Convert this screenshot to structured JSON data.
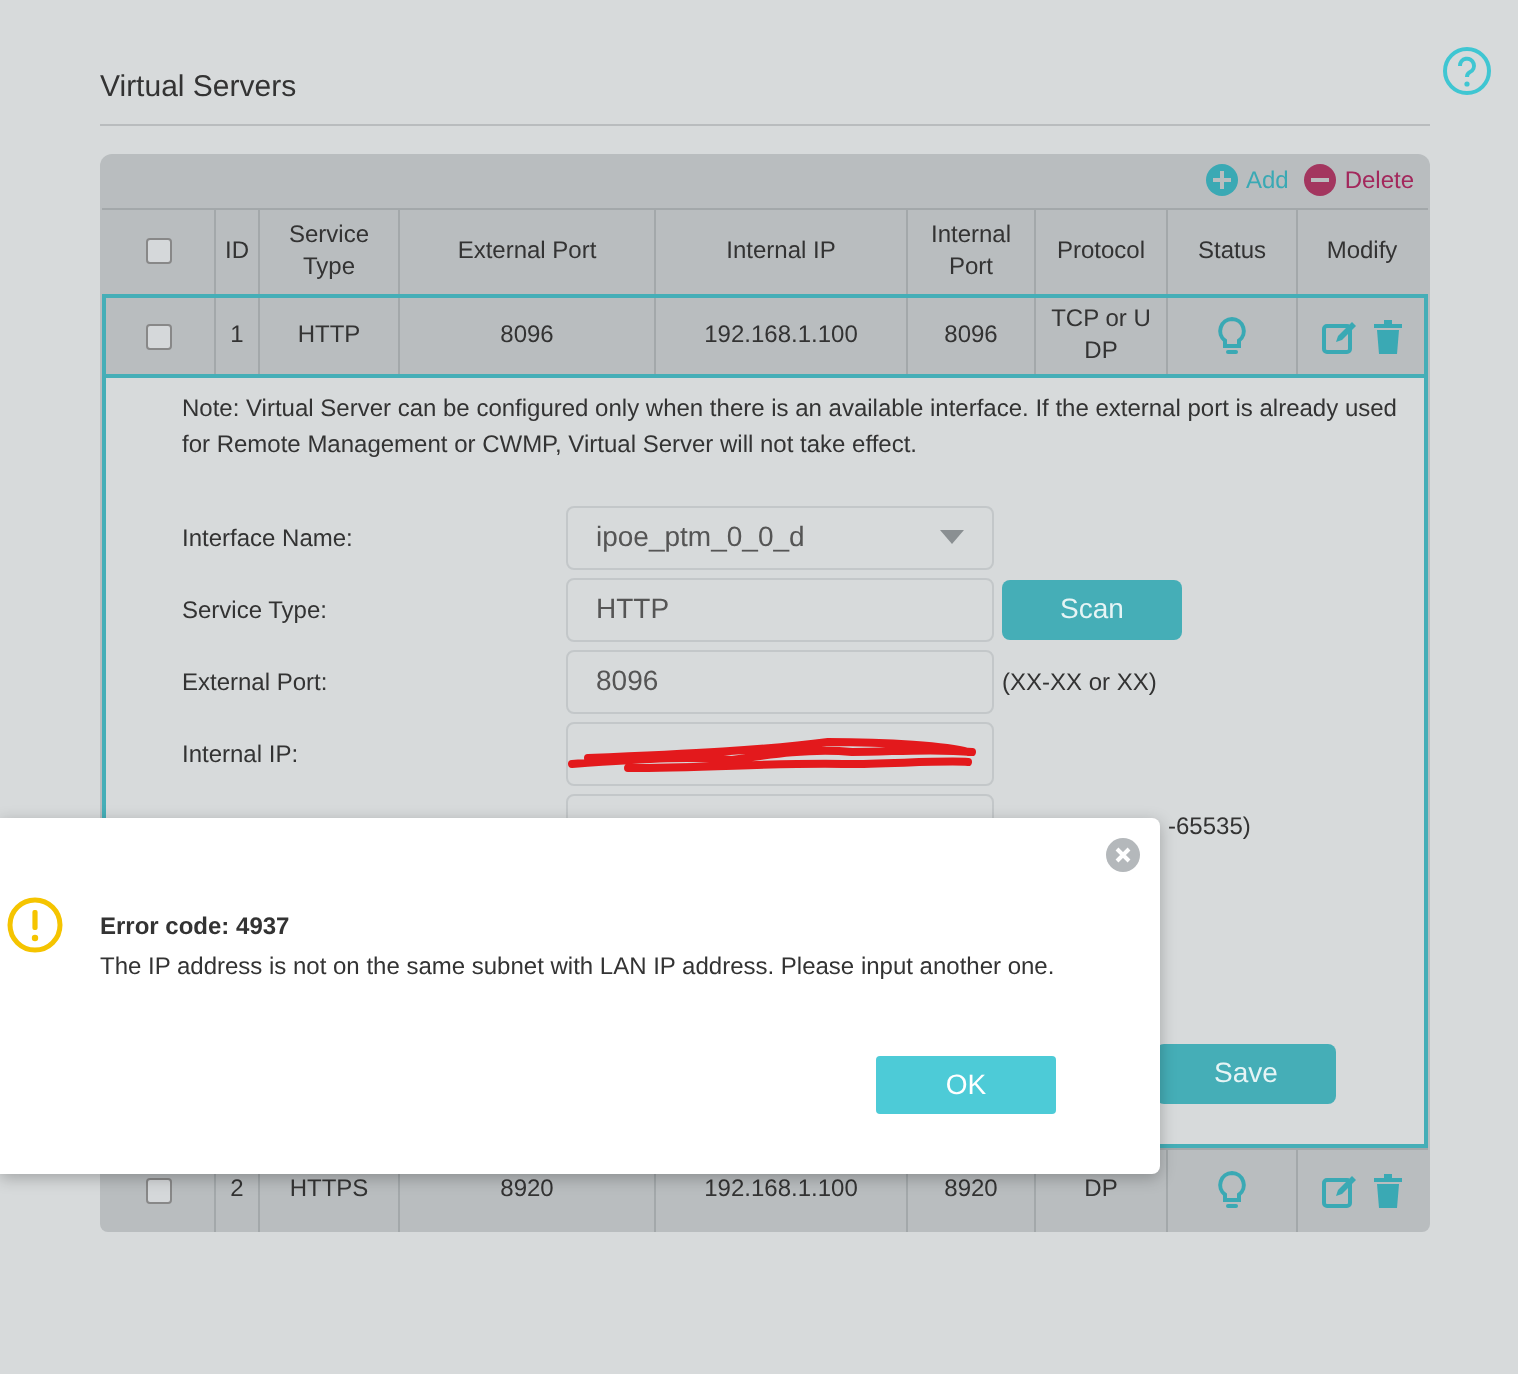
{
  "page": {
    "title": "Virtual Servers"
  },
  "toolbar": {
    "add": "Add",
    "delete": "Delete"
  },
  "table": {
    "header_checked": false,
    "columns": [
      "ID",
      "Service Type",
      "External Port",
      "Internal IP",
      "Internal Port",
      "Protocol",
      "Status",
      "Modify"
    ],
    "rows": [
      {
        "checked": false,
        "expanded": true,
        "id": "1",
        "service_type": "HTTP",
        "external_port": "8096",
        "internal_ip": "192.168.1.100",
        "internal_port": "8096",
        "protocol": "TCP or UDP"
      },
      {
        "checked": false,
        "expanded": false,
        "id": "2",
        "service_type": "HTTPS",
        "external_port": "8920",
        "internal_ip": "192.168.1.100",
        "internal_port": "8920",
        "protocol": "DP"
      }
    ]
  },
  "edit_panel": {
    "note": "Note: Virtual Server can be configured only when there is an available interface. If the external port is already used for Remote Management or CWMP, Virtual Server will not take effect.",
    "fields": [
      {
        "kind": "select",
        "label": "Interface Name:",
        "value": "ipoe_ptm_0_0_d"
      },
      {
        "kind": "text",
        "label": "Service Type:",
        "value": "HTTP",
        "button": "Scan"
      },
      {
        "kind": "text",
        "label": "External Port:",
        "value": "8096",
        "hint": "(XX-XX or XX)"
      },
      {
        "kind": "redacted",
        "label": "Internal IP:"
      },
      {
        "kind": "covered",
        "hint": "-65535)"
      }
    ],
    "save": "Save"
  },
  "dialog": {
    "title": "Error code: 4937",
    "message": "The IP address is not on the same subnet with LAN IP address. Please input another one.",
    "button": "OK"
  }
}
